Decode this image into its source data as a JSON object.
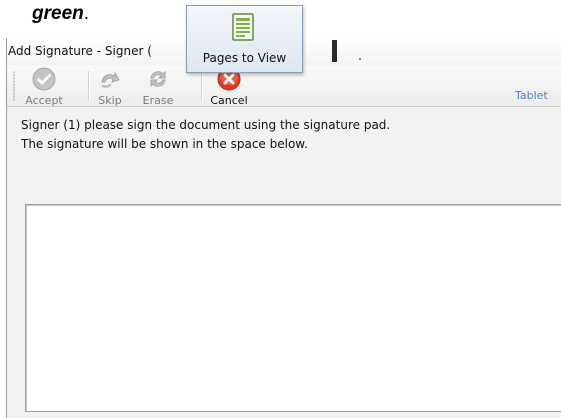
{
  "document": {
    "heading_word": "green",
    "heading_punct": "."
  },
  "window": {
    "title": "Add Signature - Signer (",
    "toolbar": {
      "accept_label": "Accept",
      "skip_label": "Skip",
      "erase_label": "Erase",
      "cancel_label": "Cancel",
      "tablet_label": "Tablet"
    },
    "instructions": {
      "line1": "Signer (1) please sign the document using the signature pad.",
      "line2": "The signature will be shown in the space below."
    }
  },
  "popup": {
    "label": "Pages to View",
    "icon": "document-list-icon"
  },
  "colors": {
    "cancel": "#e23b24",
    "disabled_icon": "#b8b8b8",
    "link": "#4a7fc6",
    "popup_border": "#8a9db2"
  }
}
